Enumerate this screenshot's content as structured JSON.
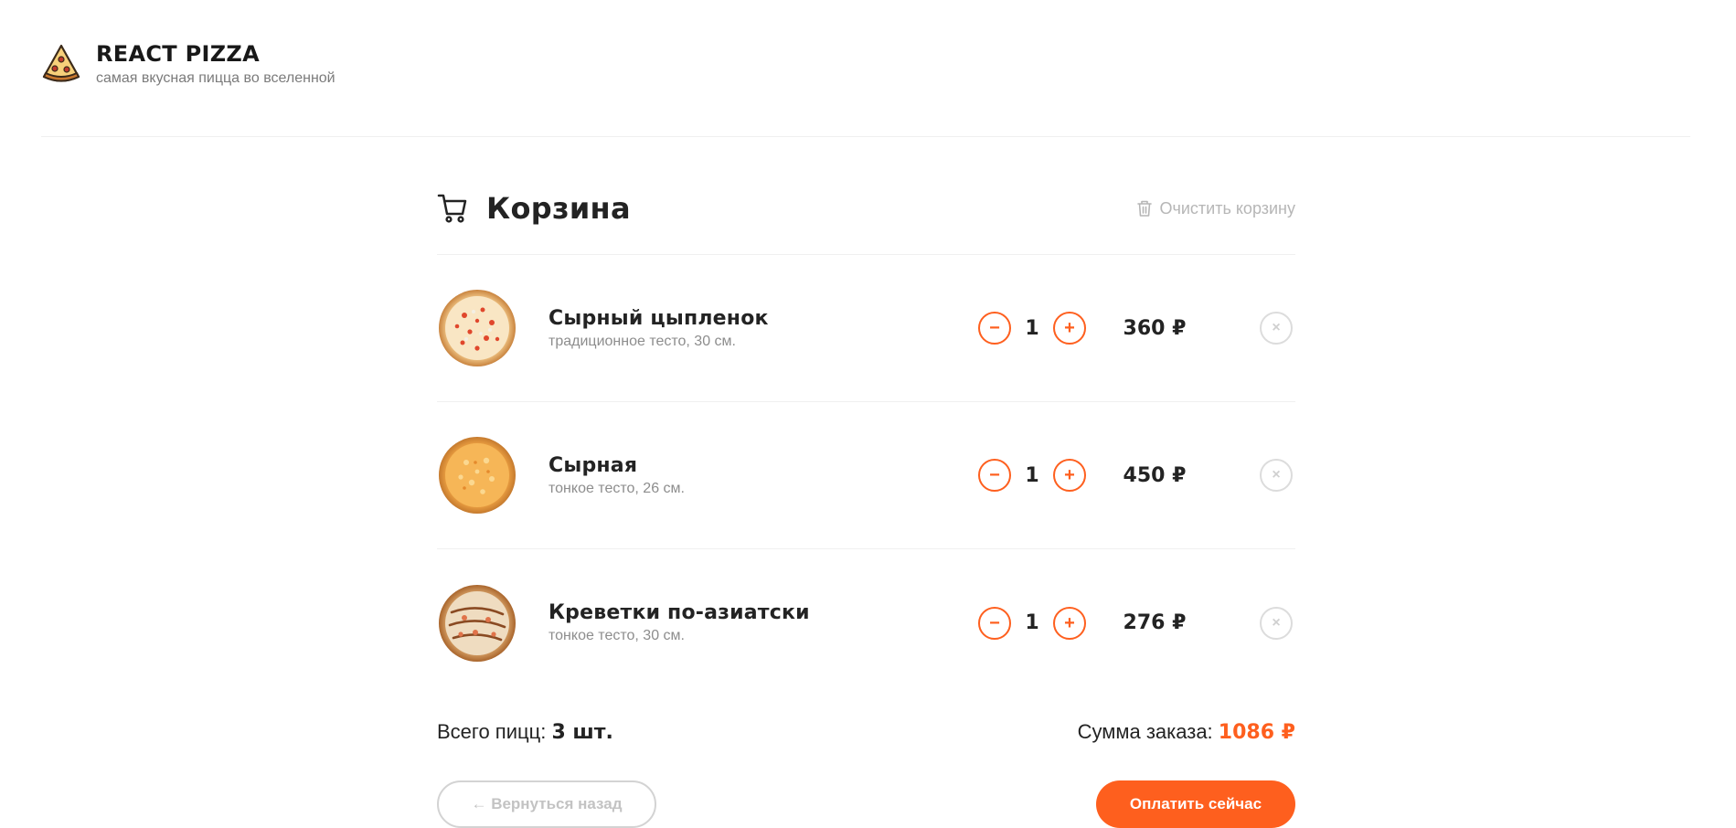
{
  "brand": {
    "title": "REACT PIZZA",
    "subtitle": "самая вкусная пицца во вселенной"
  },
  "cart": {
    "title": "Корзина",
    "clear_label": "Очистить корзину",
    "items": [
      {
        "name": "Сырный цыпленок",
        "desc": "традиционное тесто, 30 см.",
        "count": "1",
        "price": "360 ₽",
        "image": "pizza-cheese-chicken"
      },
      {
        "name": "Сырная",
        "desc": "тонкое тесто, 26 см.",
        "count": "1",
        "price": "450 ₽",
        "image": "pizza-cheese"
      },
      {
        "name": "Креветки по-азиатски",
        "desc": "тонкое тесто, 30 см.",
        "count": "1",
        "price": "276 ₽",
        "image": "pizza-shrimp"
      }
    ],
    "summary": {
      "total_label": "Всего пицц: ",
      "total_value": "3 шт.",
      "sum_label": "Сумма заказа: ",
      "sum_value": "1086 ₽"
    },
    "back_label": "← Вернуться назад",
    "pay_label": "Оплатить сейчас"
  },
  "icons": {
    "minus": "−",
    "plus": "+",
    "remove": "×"
  },
  "colors": {
    "accent": "#fe5f1e",
    "text": "#232323",
    "muted": "#8d8d8d"
  }
}
